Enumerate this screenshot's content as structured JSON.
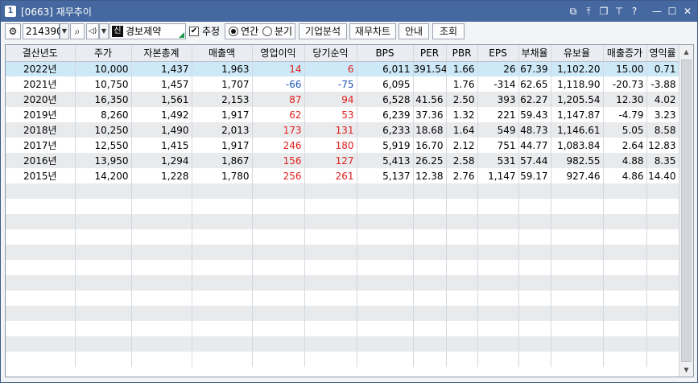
{
  "window": {
    "number": "1",
    "title": "[0663]  재무추이",
    "controls": [
      "link-icon",
      "pin-icon",
      "popup-icon",
      "pin-top-icon",
      "help-icon",
      "minimize-icon",
      "maximize-icon",
      "close-icon"
    ]
  },
  "toolbar": {
    "code": "214390",
    "stock_badge": "신",
    "stock_name": "경보제약",
    "estimate_label": "추정",
    "estimate_checked": true,
    "period_annual": "연간",
    "period_quarter": "분기",
    "period_selected": "연간",
    "btn_analysis": "기업분석",
    "btn_chart": "재무차트",
    "btn_guide": "안내",
    "btn_query": "조회"
  },
  "table": {
    "headers": [
      "결산년도",
      "주가",
      "자본총계",
      "매출액",
      "영업이익",
      "당기순익",
      "BPS",
      "PER",
      "PBR",
      "EPS",
      "부채율",
      "유보율",
      "매출증가",
      "영익률"
    ],
    "rows": [
      {
        "cells": [
          "2022년",
          "10,000",
          "1,437",
          "1,963",
          "14",
          "6",
          "6,011",
          "391.54",
          "1.66",
          "26",
          "67.39",
          "1,102.20",
          "15.00",
          "0.71"
        ],
        "colors": [
          "",
          "",
          "",
          "",
          "up",
          "up",
          "",
          "",
          "",
          "",
          "",
          "",
          "",
          ""
        ]
      },
      {
        "cells": [
          "2021년",
          "10,750",
          "1,457",
          "1,707",
          "-66",
          "-75",
          "6,095",
          "",
          "1.76",
          "-314",
          "62.65",
          "1,118.90",
          "-20.73",
          "-3.88"
        ],
        "colors": [
          "",
          "",
          "",
          "",
          "down",
          "down",
          "",
          "",
          "",
          "",
          "",
          "",
          "",
          ""
        ]
      },
      {
        "cells": [
          "2020년",
          "16,350",
          "1,561",
          "2,153",
          "87",
          "94",
          "6,528",
          "41.56",
          "2.50",
          "393",
          "62.27",
          "1,205.54",
          "12.30",
          "4.02"
        ],
        "colors": [
          "",
          "",
          "",
          "",
          "up",
          "up",
          "",
          "",
          "",
          "",
          "",
          "",
          "",
          ""
        ]
      },
      {
        "cells": [
          "2019년",
          "8,260",
          "1,492",
          "1,917",
          "62",
          "53",
          "6,239",
          "37.36",
          "1.32",
          "221",
          "59.43",
          "1,147.87",
          "-4.79",
          "3.23"
        ],
        "colors": [
          "",
          "",
          "",
          "",
          "up",
          "up",
          "",
          "",
          "",
          "",
          "",
          "",
          "",
          ""
        ]
      },
      {
        "cells": [
          "2018년",
          "10,250",
          "1,490",
          "2,013",
          "173",
          "131",
          "6,233",
          "18.68",
          "1.64",
          "549",
          "48.73",
          "1,146.61",
          "5.05",
          "8.58"
        ],
        "colors": [
          "",
          "",
          "",
          "",
          "up",
          "up",
          "",
          "",
          "",
          "",
          "",
          "",
          "",
          ""
        ]
      },
      {
        "cells": [
          "2017년",
          "12,550",
          "1,415",
          "1,917",
          "246",
          "180",
          "5,919",
          "16.70",
          "2.12",
          "751",
          "44.77",
          "1,083.84",
          "2.64",
          "12.83"
        ],
        "colors": [
          "",
          "",
          "",
          "",
          "up",
          "up",
          "",
          "",
          "",
          "",
          "",
          "",
          "",
          ""
        ]
      },
      {
        "cells": [
          "2016년",
          "13,950",
          "1,294",
          "1,867",
          "156",
          "127",
          "5,413",
          "26.25",
          "2.58",
          "531",
          "57.44",
          "982.55",
          "4.88",
          "8.35"
        ],
        "colors": [
          "",
          "",
          "",
          "",
          "up",
          "up",
          "",
          "",
          "",
          "",
          "",
          "",
          "",
          ""
        ]
      },
      {
        "cells": [
          "2015년",
          "14,200",
          "1,228",
          "1,780",
          "256",
          "261",
          "5,137",
          "12.38",
          "2.76",
          "1,147",
          "59.17",
          "927.46",
          "4.86",
          "14.40"
        ],
        "colors": [
          "",
          "",
          "",
          "",
          "up",
          "up",
          "",
          "",
          "",
          "",
          "",
          "",
          "",
          ""
        ]
      }
    ],
    "selected_row": 0
  },
  "colors": {
    "titlebar": "#4568a0",
    "selected_row": "#cde8f6",
    "alt_row": "#e9eaec",
    "positive": "#e0201e",
    "negative": "#1f57b8"
  }
}
